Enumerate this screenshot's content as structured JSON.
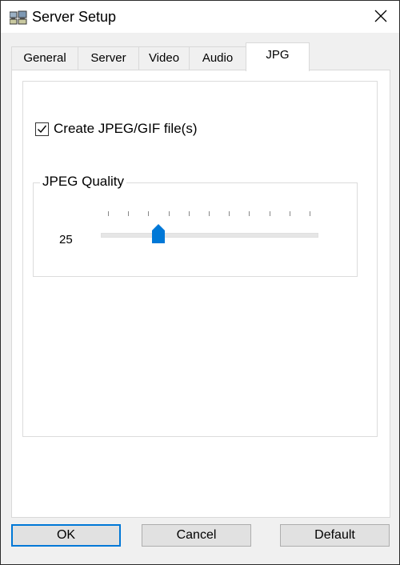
{
  "window": {
    "title": "Server Setup"
  },
  "tabs": [
    {
      "label": "General"
    },
    {
      "label": "Server"
    },
    {
      "label": "Video"
    },
    {
      "label": "Audio"
    },
    {
      "label": "JPG"
    }
  ],
  "active_tab": "JPG",
  "jpg": {
    "create_file_label": "Create JPEG/GIF file(s)",
    "create_file_checked": true,
    "quality_group_title": "JPEG Quality",
    "quality_value": "25",
    "slider": {
      "min": 0,
      "max": 100,
      "value": 25,
      "tick_count": 11
    }
  },
  "buttons": {
    "ok": "OK",
    "cancel": "Cancel",
    "default": "Default"
  },
  "colors": {
    "accent": "#0078d7",
    "window_bg": "#f0f0f0",
    "panel_bg": "#ffffff"
  },
  "icons": {
    "app": "server-setup-icon",
    "close": "close-icon",
    "check": "checkmark-icon",
    "slider_thumb": "slider-thumb-icon"
  }
}
